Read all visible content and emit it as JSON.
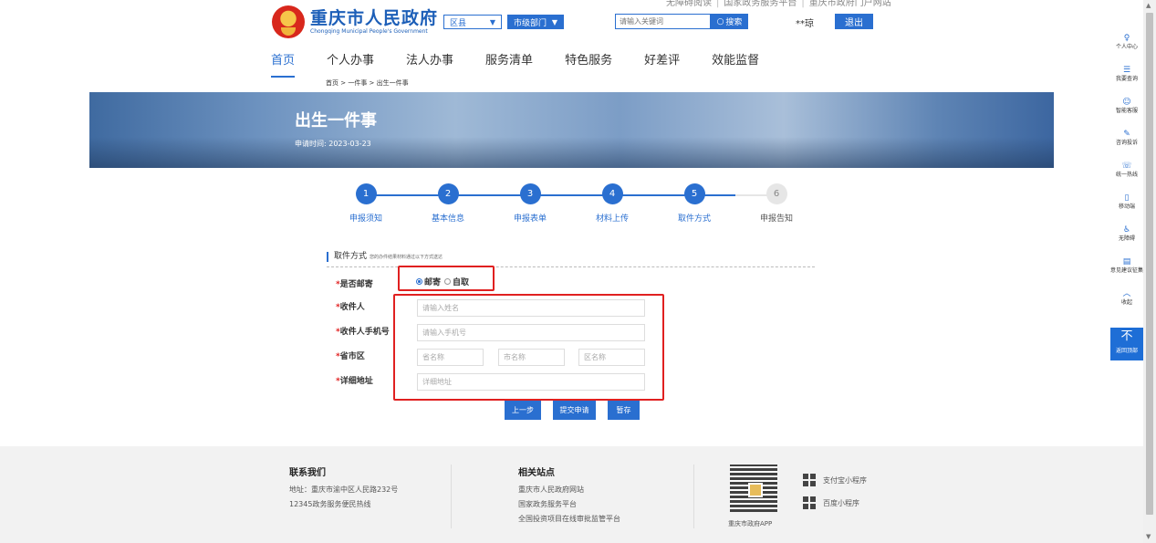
{
  "header": {
    "toplinks": [
      "无障碍阅读",
      "国家政务服务平台",
      "重庆市政府门户网站"
    ],
    "logo_cn": "重庆市人民政府",
    "logo_en": "Chongqing Municipal People's Government",
    "region_dropdown": "区县",
    "dept_dropdown": "市级部门",
    "search_placeholder": "请输入关键词",
    "search_button": "搜索",
    "user_name": "**琼",
    "logout": "退出"
  },
  "nav": {
    "items": [
      "首页",
      "个人办事",
      "法人办事",
      "服务清单",
      "特色服务",
      "好差评",
      "效能监督"
    ],
    "active_index": 0
  },
  "breadcrumb": "首页 > 一件事 > 出生一件事",
  "banner": {
    "title": "出生一件事",
    "date_label": "申请时间:",
    "date": "2023-03-23"
  },
  "steps": [
    {
      "num": "1",
      "label": "申报须知",
      "done": true
    },
    {
      "num": "2",
      "label": "基本信息",
      "done": true
    },
    {
      "num": "3",
      "label": "申报表单",
      "done": true
    },
    {
      "num": "4",
      "label": "材料上传",
      "done": true
    },
    {
      "num": "5",
      "label": "取件方式",
      "done": true
    },
    {
      "num": "6",
      "label": "申报告知",
      "done": false
    }
  ],
  "form": {
    "section_title": "取件方式",
    "section_hint": "您的办件结果材料通过以下方式送达",
    "mail_label": "是否邮寄",
    "mail_options": [
      "邮寄",
      "自取"
    ],
    "mail_selected": 0,
    "recipient_label": "收件人",
    "recipient_placeholder": "请输入姓名",
    "phone_label": "收件人手机号",
    "phone_placeholder": "请输入手机号",
    "region_label": "省市区",
    "province_placeholder": "省名称",
    "city_placeholder": "市名称",
    "district_placeholder": "区名称",
    "address_label": "详细地址",
    "address_placeholder": "详细地址",
    "required_mark": "*",
    "buttons": {
      "prev": "上一步",
      "submit": "提交申请",
      "save": "暂存"
    }
  },
  "footer": {
    "contact_title": "联系我们",
    "contact_address": "地址：重庆市渝中区人民路232号",
    "contact_hotline": "12345政务服务便民热线",
    "sites_title": "相关站点",
    "sites": [
      "重庆市人民政府网站",
      "国家政务服务平台",
      "全国投资项目在线审批监管平台"
    ],
    "app_caption": "重庆市政府APP",
    "alipay": "支付宝小程序",
    "baidu": "百度小程序"
  },
  "right_sidebar": {
    "items": [
      "个人中心",
      "我要查询",
      "智能客服",
      "咨询投诉",
      "统一热线",
      "移动端",
      "无障碍",
      "意见建议征集",
      "收起"
    ],
    "back_top": "返回顶部"
  },
  "colors": {
    "primary": "#2a6fd0",
    "required": "#e02020",
    "highlight": "#e02020"
  }
}
